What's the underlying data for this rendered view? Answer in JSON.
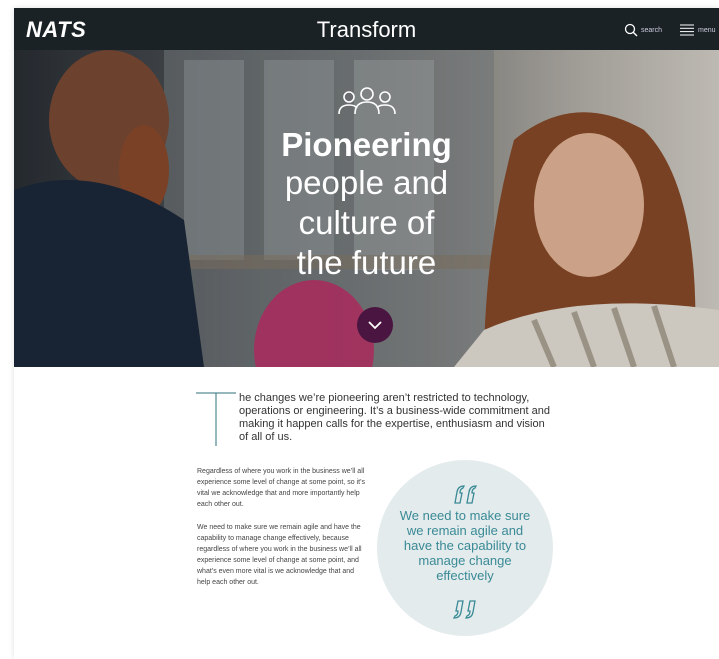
{
  "header": {
    "logo": "NATS",
    "title": "Transform",
    "search_label": "search",
    "menu_label": "menu"
  },
  "hero": {
    "heading_bold": "Pioneering",
    "heading_lines": [
      "people and",
      "culture of",
      "the future"
    ],
    "icon": "people-group-icon",
    "scroll_icon": "chevron-down-icon",
    "scroll_button_color": "#4a1540"
  },
  "intro": {
    "dropcap": "T",
    "text": "he changes we’re pioneering aren’t restricted to technology, operations or engineering. It’s a business-wide commitment and making it happen calls for the expertise, enthusiasm and vision of all of us."
  },
  "body": {
    "paragraphs": [
      "Regardless of where you work in the business we’ll all experience some level of change at some point, so it’s vital we acknowledge that and more importantly help each other out.",
      "We need to make sure we remain agile and have the capability to manage change effectively, because regardless of where you work in the business we’ll all experience some level of change at some point, and what’s even more vital is we acknowledge that and help each other out."
    ]
  },
  "quote": {
    "text": "We need to make sure we remain agile and have the capability to manage change effectively",
    "color": "#3a8a96",
    "background": "#e3ebec"
  }
}
